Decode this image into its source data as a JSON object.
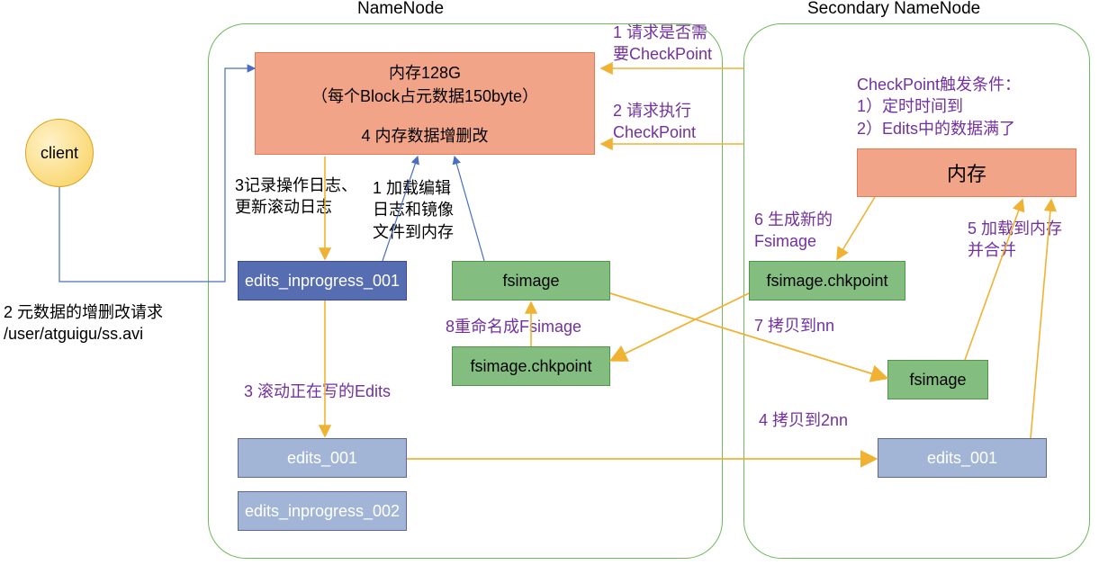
{
  "client": "client",
  "request_text": "2 元数据的增删改请求\n/user/atguigu/ss.avi",
  "namenode": {
    "title": "NameNode",
    "memory_box_l1": "内存128G",
    "memory_box_l2": "（每个Block占元数据150byte）",
    "memory_box_l3": "4 内存数据增删改",
    "step3_label": "3记录操作日志、\n更新滚动日志",
    "step1_label": "1 加载编辑\n日志和镜像\n文件到内存",
    "edits_inprogress_001": "edits_inprogress_001",
    "fsimage": "fsimage",
    "rename_label": "8重命名成Fsimage",
    "fsimage_chkpoint": "fsimage.chkpoint",
    "roll_label": "3 滚动正在写的Edits",
    "edits_001": "edits_001",
    "edits_inprogress_002": "edits_inprogress_002"
  },
  "arrows": {
    "req1": "1 请求是否需\n要CheckPoint",
    "req2": "2 请求执行\nCheckPoint"
  },
  "secondary": {
    "title": "Secondary NameNode",
    "trigger": "CheckPoint触发条件：\n1）定时时间到\n2）Edits中的数据满了",
    "memory": "内存",
    "step6": "6 生成新的\nFsimage",
    "fsimage_chkpoint": "fsimage.chkpoint",
    "step7": "7 拷贝到nn",
    "step5": "5 加载到内存\n并合并",
    "fsimage": "fsimage",
    "step4": "4 拷贝到2nn",
    "edits_001": "edits_001"
  }
}
